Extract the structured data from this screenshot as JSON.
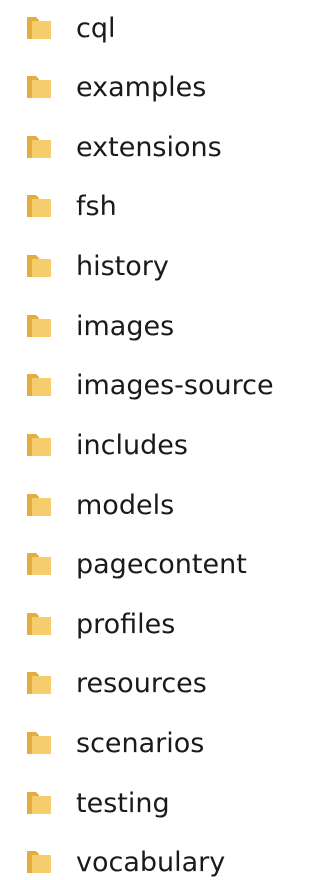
{
  "folder_icon": {
    "icon": "folder-icon",
    "back_color": "#e3ad3f",
    "front_color": "#f6cd6c"
  },
  "folders": [
    {
      "label": "cql"
    },
    {
      "label": "examples"
    },
    {
      "label": "extensions"
    },
    {
      "label": "fsh"
    },
    {
      "label": "history"
    },
    {
      "label": "images"
    },
    {
      "label": "images-source"
    },
    {
      "label": "includes"
    },
    {
      "label": "models"
    },
    {
      "label": "pagecontent"
    },
    {
      "label": "profiles"
    },
    {
      "label": "resources"
    },
    {
      "label": "scenarios"
    },
    {
      "label": "testing"
    },
    {
      "label": "vocabulary"
    }
  ]
}
